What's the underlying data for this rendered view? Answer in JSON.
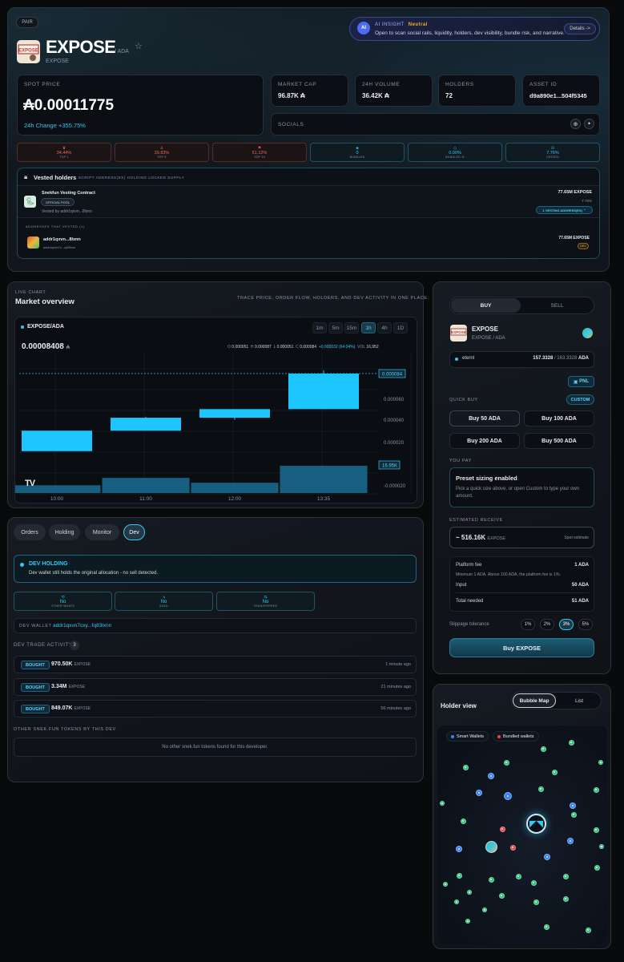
{
  "header": {
    "pair_badge": "PAIR",
    "token_name": "EXPOSE",
    "token_quote": "/ ADA",
    "token_sub": "EXPOSE",
    "ai_insight": {
      "label": "AI INSIGHT",
      "sentiment": "Neutral",
      "text": "Open to scan social rails, liquidity, holders, dev visibility, bundle risk, and narrative.",
      "details": "Details ->"
    }
  },
  "stats": {
    "spot_price_label": "SPOT PRICE",
    "spot_price": "₳0.00011775",
    "change_label": "24h Change",
    "change_value": "+355.75%",
    "market_cap_label": "MARKET CAP",
    "market_cap": "96.87K ₳",
    "volume_label": "24H VOLUME",
    "volume": "36.42K ₳",
    "holders_label": "HOLDERS",
    "holders": "72",
    "asset_id_label": "ASSET ID",
    "asset_id": "d9a890e1...504f5345",
    "socials_label": "SOCIALS"
  },
  "risks": [
    {
      "icon": "♛",
      "value": "34.44%",
      "title": "TOP 1",
      "tone": "red"
    },
    {
      "icon": "♙",
      "value": "39.83%",
      "title": "TOP 5",
      "tone": "red"
    },
    {
      "icon": "⚑",
      "value": "51.12%",
      "title": "TOP 10",
      "tone": "red"
    },
    {
      "icon": "◈",
      "value": "0",
      "title": "BUNDLED",
      "tone": "cyan"
    },
    {
      "icon": "◇",
      "value": "0.00%",
      "title": "BUNDLED %",
      "tone": "cyan"
    },
    {
      "icon": "⊙",
      "value": "7.76%",
      "title": "VESTED",
      "tone": "cyan"
    }
  ],
  "vested": {
    "title": "Vested holders",
    "subtitle": "1 SCRIPT ADDRESS(ES) HOLDING LOCKED SUPPLY",
    "contract_name": "Snekfun Vesting Contract",
    "official_badge": "OFFICIAL POOL",
    "vested_by": "Vested by addr1qxvn...8lxnn",
    "amount": "77.65M EXPOSE",
    "percent": "7.76%",
    "vesting_addresses_btn": "1 VESTING ADDRESS(ES)",
    "addresses_label": "ADDRESSES THAT VESTED (1)",
    "address_short": "addr1qxvn...8lxnn",
    "address_sub": "addr1qxvn7c...q83lxnn",
    "address_amount": "77.65M EXPOSE",
    "dev_badge": "DEV"
  },
  "market": {
    "live_label": "LIVE CHART",
    "title": "Market overview",
    "tagline": "TRACE PRICE, ORDER FLOW, HOLDERS, AND DEV ACTIVITY IN ONE PLACE.",
    "pair": "EXPOSE/ADA",
    "timeframes": [
      "1m",
      "5m",
      "15m",
      "1h",
      "4h",
      "1D"
    ],
    "active_tf": "1h",
    "last_price": "0.00008408",
    "last_price_unit": "₳",
    "ohlc": {
      "o_label": "O",
      "o": "0.000051",
      "h_label": "H",
      "h": "0.000087",
      "l_label": "L",
      "l": "0.000051",
      "c_label": "C",
      "c": "0.000084",
      "change": "+0.000032 (64.04%)",
      "vol_label": "VOL",
      "vol": "16,952"
    },
    "tv_logo": "TV"
  },
  "chart_data": {
    "type": "candlestick",
    "x": [
      "10:00",
      "11:00",
      "12:00",
      "13:35"
    ],
    "candles": [
      {
        "time": "10:00",
        "open": 1.2e-05,
        "high": 3.1e-05,
        "low": 1.2e-05,
        "close": 3.1e-05,
        "volume": 3200
      },
      {
        "time": "11:00",
        "open": 3.1e-05,
        "high": 4.4e-05,
        "low": 3.1e-05,
        "close": 4.3e-05,
        "volume": 8400
      },
      {
        "time": "12:00",
        "open": 4.3e-05,
        "high": 5.1e-05,
        "low": 4.1e-05,
        "close": 5.1e-05,
        "volume": 5000
      },
      {
        "time": "13:35",
        "open": 5.1e-05,
        "high": 8.7e-05,
        "low": 5.1e-05,
        "close": 8.4e-05,
        "volume": 16952
      }
    ],
    "yticks": [
      "0.000060",
      "0.000040",
      "0.000020",
      "-0.000020"
    ],
    "price_marker": "0.000084",
    "volume_marker": "16.95K",
    "ylim": [
      -2.5e-05,
      0.0001
    ],
    "grid": true
  },
  "dev": {
    "tabs": [
      "Orders",
      "Holding",
      "Monitor",
      "Dev"
    ],
    "active_tab": "Dev",
    "holding_title": "DEV HOLDING",
    "holding_text": "Dev wallet still holds the original allocation - no sell detected.",
    "boxes": [
      {
        "icon": "⟲",
        "value": "No",
        "title": "OTHER WHATS"
      },
      {
        "icon": "↘",
        "value": "No",
        "title": "SOLD"
      },
      {
        "icon": "⇆",
        "value": "No",
        "title": "TRANSFERRED"
      }
    ],
    "wallet_label": "DEV WALLET",
    "wallet": "addr1qxvn7cxy...fq83lxnn",
    "activity_label": "DEV TRADE ACTIVITY",
    "activity_count": "3",
    "trades": [
      {
        "type": "BOUGHT",
        "amount": "970.50K",
        "unit": "EXPOSE",
        "time": "1 minute ago"
      },
      {
        "type": "BOUGHT",
        "amount": "3.34M",
        "unit": "EXPOSE",
        "time": "21 minutes ago"
      },
      {
        "type": "BOUGHT",
        "amount": "849.07K",
        "unit": "EXPOSE",
        "time": "56 minutes ago"
      }
    ],
    "other_label": "OTHER SNEK.FUN TOKENS BY THIS DEV",
    "other_empty": "No other snek.fun tokens found for this developer."
  },
  "trade": {
    "buy_tab": "BUY",
    "sell_tab": "SELL",
    "token_name": "EXPOSE",
    "token_pair": "EXPOSE / ADA",
    "wallet_name": "eternl",
    "balance": "157.3328",
    "balance_total": "/ 163.3328",
    "balance_unit": "ADA",
    "pnl_btn": "PNL",
    "quick_buy_label": "QUICK BUY",
    "custom_btn": "CUSTOM",
    "quick_buttons": [
      "Buy 50 ADA",
      "Buy 100 ADA",
      "Buy 200 ADA",
      "Buy 500 ADA"
    ],
    "you_pay_label": "YOU PAY",
    "preset_title": "Preset sizing enabled",
    "preset_text": "Pick a quick size above, or open Custom to type your own amount.",
    "estimated_label": "ESTIMATED RECEIVE",
    "estimated_value": "~ 516.16K",
    "estimated_unit": "EXPOSE",
    "estimated_note": "Spot estimate",
    "platform_fee_label": "Platform fee",
    "platform_fee": "1 ADA",
    "fee_note": "Minimum 1 ADA. Above 100 ADA, the platform fee is 1%.",
    "input_label": "Input",
    "input": "50 ADA",
    "total_label": "Total needed",
    "total": "51 ADA",
    "slippage_label": "Slippage tolerance",
    "slippage_options": [
      "1%",
      "2%",
      "3%",
      "5%"
    ],
    "slippage_active": "3%",
    "buy_button": "Buy EXPOSE"
  },
  "holder_view": {
    "title": "Holder view",
    "tabs": [
      "Bubble Map",
      "List"
    ],
    "active_tab": "Bubble Map",
    "legend_smart": "Smart Wallets",
    "legend_bundled": "Bundled wallets"
  },
  "colors": {
    "accent": "#37c8f2",
    "candle": "#1ec6ff",
    "volume": "#1a6f95",
    "danger": "#ef6464",
    "neutral": "#f0b429",
    "background": "#090a0c"
  }
}
